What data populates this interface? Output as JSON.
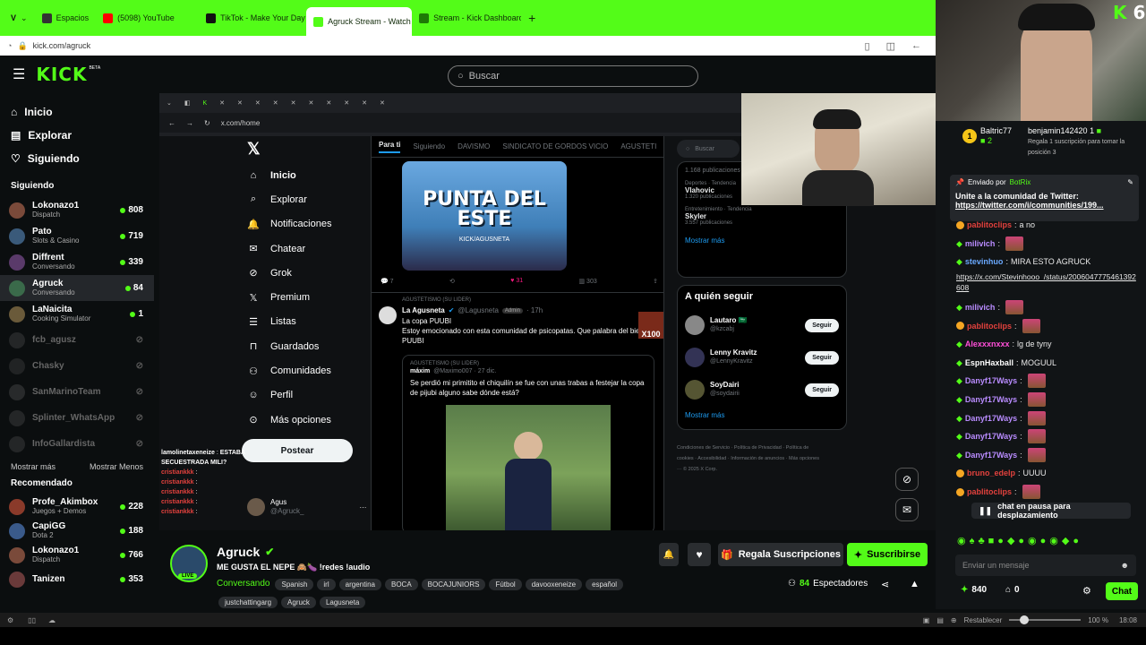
{
  "browser": {
    "tabs": [
      {
        "label": "Espacios",
        "icon": "spaces-icon",
        "color": "#3c3c3c"
      },
      {
        "label": "(5098) YouTube",
        "icon": "youtube-icon",
        "color": "#ff0000"
      },
      {
        "label": "TikTok - Make Your Day",
        "icon": "tiktok-icon",
        "color": "#111111"
      },
      {
        "label": "Agruck Stream - Watch Live",
        "icon": "kick-icon",
        "color": "#53fc18"
      },
      {
        "label": "Stream - Kick Dashboard",
        "icon": "kick-icon",
        "color": "#53fc18"
      }
    ],
    "url": "kick.com/agruck"
  },
  "header": {
    "logo": "KICK",
    "beta": "BETA",
    "search_placeholder": "Buscar"
  },
  "sidebar": {
    "nav": [
      {
        "label": "Inicio",
        "icon": "home-icon"
      },
      {
        "label": "Explorar",
        "icon": "compass-icon"
      },
      {
        "label": "Siguiendo",
        "icon": "heart-icon"
      }
    ],
    "following_title": "Siguiendo",
    "following": [
      {
        "name": "Lokonazo1",
        "sub": "Dispatch",
        "count": "808",
        "live": true
      },
      {
        "name": "Pato",
        "sub": "Slots & Casino",
        "count": "719",
        "live": true
      },
      {
        "name": "Diffrent",
        "sub": "Conversando",
        "count": "339",
        "live": true
      },
      {
        "name": "Agruck",
        "sub": "Conversando",
        "count": "84",
        "live": true
      },
      {
        "name": "LaNaicita",
        "sub": "Cooking Simulator",
        "count": "1",
        "live": true
      },
      {
        "name": "fcb_agusz",
        "sub": "",
        "count": "",
        "live": false
      },
      {
        "name": "Chasky",
        "sub": "",
        "count": "",
        "live": false
      },
      {
        "name": "SanMarinoTeam",
        "sub": "",
        "count": "",
        "live": false
      },
      {
        "name": "Splinter_WhatsApp",
        "sub": "",
        "count": "",
        "live": false
      },
      {
        "name": "InfoGallardista",
        "sub": "",
        "count": "",
        "live": false
      }
    ],
    "show_more": "Mostrar más",
    "show_less": "Mostrar Menos",
    "recommended_title": "Recomendado",
    "recommended": [
      {
        "name": "Profe_Akimbox",
        "sub": "Juegos + Demos",
        "count": "228"
      },
      {
        "name": "CapiGG",
        "sub": "Dota 2",
        "count": "188"
      },
      {
        "name": "Lokonazo1",
        "sub": "Dispatch",
        "count": "766"
      },
      {
        "name": "Tanizen",
        "sub": "",
        "count": "353"
      }
    ]
  },
  "video": {
    "inner_url": "x.com/home",
    "x_nav": [
      "Inicio",
      "Explorar",
      "Notificaciones",
      "Chatear",
      "Grok",
      "Premium",
      "Listas",
      "Guardados",
      "Comunidades",
      "Perfil",
      "Más opciones"
    ],
    "post_button": "Postear",
    "x_tabs": [
      "Para ti",
      "Siguiendo",
      "DAVISMO",
      "SINDICATO DE GORDOS VICIO",
      "AGUSTETI"
    ],
    "x_search": "Buscar",
    "trending": [
      {
        "meta": "1.168 publicaciones",
        "topic": "",
        "sub": ""
      },
      {
        "meta": "Deportes · Tendencia",
        "topic": "Vlahovic",
        "sub": "1.320 publicaciones"
      },
      {
        "meta": "Entretenimiento · Tendencia",
        "topic": "Skyler",
        "sub": "3.557 publicaciones"
      }
    ],
    "show_more": "Mostrar más",
    "who_to_follow": "A quién seguir",
    "follow_suggestions": [
      {
        "name": "Lautaro 🇸🇦",
        "handle": "@kzcabj",
        "btn": "Seguir"
      },
      {
        "name": "Lenny Kravitz",
        "handle": "@LennyKravitz",
        "btn": "Seguir"
      },
      {
        "name": "SoyDairi",
        "handle": "@soydairii",
        "btn": "Seguir"
      }
    ],
    "footer_links": "Condiciones de Servicio · Política de Privacidad · Política de cookies · Accesibilidad · Información de anuncios · Más opciones ··· © 2025 X Corp.",
    "post_image_text": "PUNTA DEL ESTE",
    "post_image_sub": "KICK/AGUSNETA",
    "post_stats": {
      "replies": "7",
      "likes": "31",
      "views": "303"
    },
    "community_label": "AGUSTETISMO (SU LIDER)",
    "post_author": "La Agusneta",
    "post_handle": "@Lagusneta",
    "post_badge": "Admin",
    "post_time": "· 17h",
    "post_text_1": "La copa PUUBI",
    "post_text_2": "Estoy emocionado con esta comunidad de psicopatas. Que palabra del bien PUUBI",
    "quote_label": "AGUSTETISMO (SU LIDER)",
    "quote_author": "máxim",
    "quote_handle": "@Maximo007 · 27 dic.",
    "quote_text": "Se perdió mi primitito el chiquilín se fue con unas trabas a festejar la copa de pijubi alguno sabe dónde está?",
    "profile_name": "Agus",
    "profile_handle": "@Agruck_",
    "overlay_chat": [
      {
        "user": "lamolinetaxeneize",
        "text": "ESTABA SECUESTRADA MILI?"
      },
      {
        "user": "cristiankkk",
        "text": ""
      },
      {
        "user": "cristiankkk",
        "text": ""
      },
      {
        "user": "cristiankkk",
        "text": ""
      },
      {
        "user": "cristiankkk",
        "text": ""
      },
      {
        "user": "cristiankkk",
        "text": ""
      }
    ],
    "x100": "X100"
  },
  "stream": {
    "name": "Agruck",
    "title": "ME GUSTA EL NEPE 🙈🍆 !redes !audio",
    "category": "Conversando",
    "tags_row1": [
      "Spanish",
      "irl",
      "argentina",
      "BOCA",
      "BOCAJUNIORS",
      "Fútbol",
      "davooxeneize",
      "español"
    ],
    "tags_row2": [
      "justchattingarg",
      "Agruck",
      "Lagusneta"
    ],
    "live": "LIVE",
    "gift_btn": "Regala Suscripciones",
    "sub_btn": "Suscribirse",
    "viewers": "84",
    "viewers_label": "Espectadores"
  },
  "chat": {
    "gifter1": {
      "name": "Baltric77",
      "count": "2"
    },
    "gifter2": {
      "name": "benjamin142420",
      "count": "1",
      "sub": "Regala 1 suscripción para tomar la posición 3"
    },
    "pinned_by": "Enviado por",
    "pinned_user": "BotRix",
    "pinned_text": "Unite a la comunidad de Twitter:",
    "pinned_link": "https://twitter.com/i/communities/199...",
    "messages": [
      {
        "user": "pablitoclips",
        "text": "a no",
        "color": "#e2413d"
      },
      {
        "user": "milivich",
        "text": "",
        "color": "#b98cff"
      },
      {
        "user": "stevinhuo",
        "text": "MIRA ESTO AGRUCK",
        "color": "#6aa9ff"
      },
      {
        "user": "",
        "text": "https://x.com/Stevinhooo_/status/2006047775461392608",
        "color": "#ffffff"
      },
      {
        "user": "milivich",
        "text": "",
        "color": "#b98cff"
      },
      {
        "user": "pablitoclips",
        "text": "",
        "color": "#e2413d"
      },
      {
        "user": "Alexxxnxxx",
        "text": "lg de tyny",
        "color": "#ff4fd8"
      },
      {
        "user": "EspnHaxball",
        "text": "MOGUUL",
        "color": "#ffffff"
      },
      {
        "user": "Danyf17Ways",
        "text": "",
        "color": "#b98cff"
      },
      {
        "user": "Danyf17Ways",
        "text": "",
        "color": "#b98cff"
      },
      {
        "user": "Danyf17Ways",
        "text": "",
        "color": "#b98cff"
      },
      {
        "user": "Danyf17Ways",
        "text": "",
        "color": "#b98cff"
      },
      {
        "user": "Danyf17Ways",
        "text": "",
        "color": "#b98cff"
      },
      {
        "user": "bruno_edelp",
        "text": "UUUU",
        "color": "#e2413d"
      },
      {
        "user": "pablitoclips",
        "text": "",
        "color": "#e2413d"
      }
    ],
    "paused": "chat en pausa para desplazamiento",
    "input_placeholder": "Enviar un mensaje",
    "points": "840",
    "other_count": "0",
    "chat_btn": "Chat"
  },
  "statusbar": {
    "reset": "Restablecer",
    "zoom": "100 %",
    "time": "18:08"
  }
}
